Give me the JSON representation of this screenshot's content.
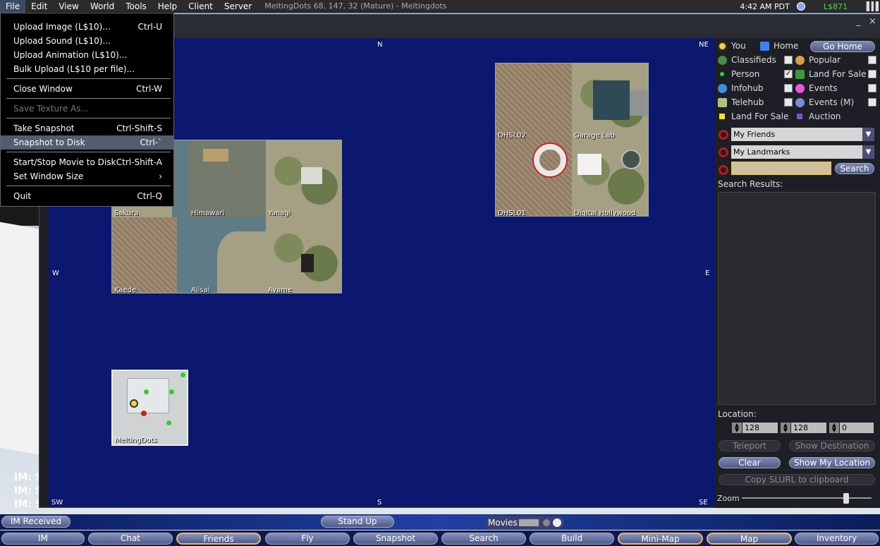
{
  "menubar": {
    "items": [
      "File",
      "Edit",
      "View",
      "World",
      "Tools",
      "Help",
      "Client",
      "Server"
    ],
    "title": "MeltingDots 68, 147, 32 (Mature) - Meltingdots",
    "clock": "4:42 AM PDT",
    "balance": "L$871"
  },
  "file_menu": {
    "upload_image": "Upload Image (L$10)...",
    "upload_image_key": "Ctrl-U",
    "upload_sound": "Upload Sound (L$10)...",
    "upload_animation": "Upload Animation (L$10)...",
    "bulk_upload": "Bulk Upload (L$10 per file)...",
    "close_window": "Close Window",
    "close_window_key": "Ctrl-W",
    "save_texture": "Save Texture As...",
    "take_snapshot": "Take Snapshot",
    "take_snapshot_key": "Ctrl-Shift-S",
    "snapshot_disk": "Snapshot to Disk",
    "snapshot_disk_key": "Ctrl-`",
    "movie": "Start/Stop Movie to Disk",
    "movie_key": "Ctrl-Shift-A",
    "window_size": "Set Window Size",
    "window_size_arrow": "›",
    "quit": "Quit",
    "quit_key": "Ctrl-Q"
  },
  "floater": {
    "min": "_",
    "close": "×"
  },
  "compass": {
    "n": "N",
    "ne": "NE",
    "e": "E",
    "se": "SE",
    "s": "S",
    "sw": "SW",
    "w": "W"
  },
  "regions": {
    "dhsl02": "DHSL02",
    "garage_lab": "Garage Lab",
    "dhsl01": "DHSL01",
    "digital_hollywood": "Digital Hollywood",
    "sakura": "Sakura",
    "himawari": "Himawari",
    "yanagi": "Yanagi",
    "kaede": "Kaede",
    "ajisai": "Ajisai",
    "ayame": "Ayame",
    "meltingdots": "MeltingDots"
  },
  "sidebar": {
    "you": "You",
    "home": "Home",
    "go_home": "Go Home",
    "classifieds": "Classifieds",
    "popular": "Popular",
    "person": "Person",
    "land_for_sale": "Land For Sale",
    "infohub": "Infohub",
    "events": "Events",
    "telehub": "Telehub",
    "events_m": "Events (M)",
    "legend_land": "Land For Sale",
    "legend_auction": "Auction",
    "friends_combo": "My Friends",
    "landmarks_combo": "My Landmarks",
    "search_btn": "Search",
    "search_results": "Search Results:",
    "location": "Location:",
    "loc_x": "128",
    "loc_y": "128",
    "loc_z": "0",
    "teleport": "Teleport",
    "show_destination": "Show Destination",
    "clear": "Clear",
    "show_my_location": "Show My Location",
    "copy_slurl": "Copy SLURL to clipboard",
    "zoom": "Zoom"
  },
  "world": {
    "im1": "IM: S",
    "im2": "IM: S",
    "im3": "IM: S"
  },
  "statusbar": {
    "im_received": "IM Received",
    "stand_up": "Stand Up",
    "movies": "Movies"
  },
  "toolbar": {
    "im": "IM",
    "chat": "Chat",
    "friends": "Friends",
    "fly": "Fly",
    "snapshot": "Snapshot",
    "search": "Search",
    "build": "Build",
    "minimap": "Mini-Map",
    "map": "Map",
    "inventory": "Inventory"
  }
}
